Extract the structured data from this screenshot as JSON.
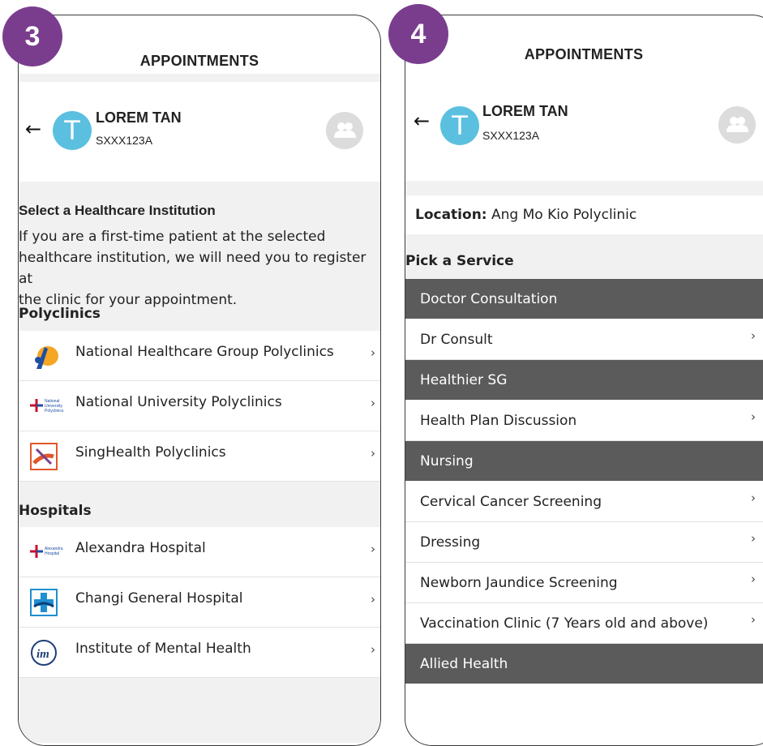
{
  "badges": [
    "3",
    "4"
  ],
  "screen3": {
    "title": "APPOINTMENTS",
    "user": {
      "initial": "T",
      "name": "LOREM TAN",
      "id": "SXXX123A"
    },
    "section_title": "Select a Healthcare Institution",
    "intro_lines": [
      "If you are a first-time patient at the selected",
      "healthcare institution, we will need you to register at",
      "the clinic for your appointment."
    ],
    "polyclinics_heading": "Polyclinics",
    "polyclinics": [
      {
        "label": "National Healthcare Group Polyclinics",
        "logo": "nhg-logo"
      },
      {
        "label": "National University Polyclinics",
        "logo": "nup-logo",
        "logo_text": [
          "National",
          "University",
          "Polyclinics"
        ]
      },
      {
        "label": "SingHealth Polyclinics",
        "logo": "singhealth-logo"
      }
    ],
    "hospitals_heading": "Hospitals",
    "hospitals": [
      {
        "label": "Alexandra Hospital",
        "logo": "alexandra-logo",
        "logo_text": [
          "Alexandra",
          "Hospital"
        ]
      },
      {
        "label": "Changi General Hospital",
        "logo": "changi-logo"
      },
      {
        "label": "Institute of Mental Health",
        "logo": "imh-logo"
      }
    ]
  },
  "screen4": {
    "title": "APPOINTMENTS",
    "user": {
      "initial": "T",
      "name": "LOREM TAN",
      "id": "SXXX123A"
    },
    "location_label": "Location:",
    "location_value": "Ang Mo Kio Polyclinic",
    "pick_heading": "Pick a Service",
    "services": [
      {
        "type": "header",
        "label": "Doctor Consultation"
      },
      {
        "type": "item",
        "label": "Dr Consult"
      },
      {
        "type": "header",
        "label": "Healthier SG"
      },
      {
        "type": "item",
        "label": "Health Plan Discussion"
      },
      {
        "type": "header",
        "label": "Nursing"
      },
      {
        "type": "item",
        "label": "Cervical Cancer Screening"
      },
      {
        "type": "item",
        "label": "Dressing"
      },
      {
        "type": "item",
        "label": "Newborn Jaundice Screening"
      },
      {
        "type": "item",
        "label": "Vaccination Clinic (7 Years old and above)"
      },
      {
        "type": "header",
        "label": "Allied Health"
      }
    ]
  },
  "glyphs": {
    "back": "←",
    "chevron": "›"
  },
  "colors": {
    "badge": "#7a3d8e",
    "avatar": "#5bc0e0",
    "service_header": "#5b5b5b"
  }
}
